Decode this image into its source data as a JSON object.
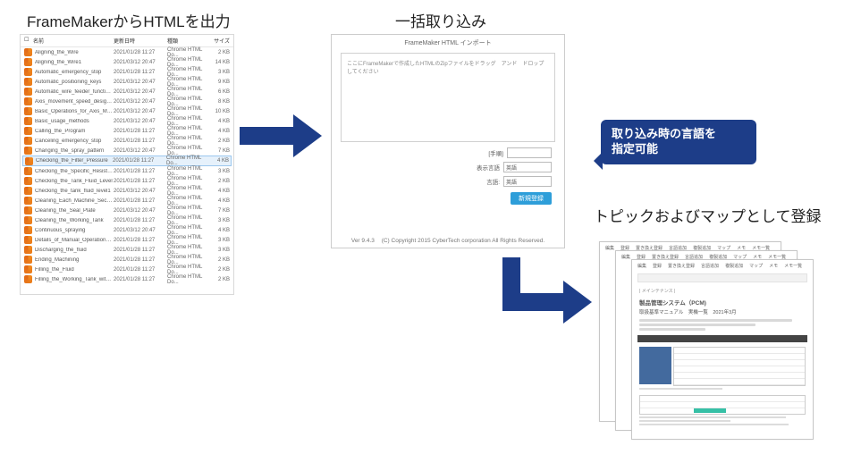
{
  "captions": {
    "export": "FrameMakerからHTMLを出力",
    "import": "一括取り込み",
    "register": "トピックおよびマップとして登録"
  },
  "callout": {
    "line1": "取り込み時の言語を",
    "line2": "指定可能"
  },
  "explorer": {
    "columns": {
      "name": "名前",
      "date": "更新日時",
      "type": "種類",
      "size": "サイズ"
    },
    "type_label": "Chrome HTML Do...",
    "selected_index": 11,
    "files": [
      {
        "name": "Aligning_the_Wire",
        "date": "2021/01/28 11:27",
        "size": "2 KB"
      },
      {
        "name": "Aligning_the_Wire1",
        "date": "2021/03/12 20:47",
        "size": "14 KB"
      },
      {
        "name": "Automatic_emergency_stop",
        "date": "2021/01/28 11:27",
        "size": "3 KB"
      },
      {
        "name": "Automatic_positioning_keys",
        "date": "2021/03/12 20:47",
        "size": "9 KB"
      },
      {
        "name": "Automatic_wire_feeder_function_keys",
        "date": "2021/03/12 20:47",
        "size": "6 KB"
      },
      {
        "name": "Axis_movement_speed_designation_k...",
        "date": "2021/03/12 20:47",
        "size": "8 KB"
      },
      {
        "name": "Basic_Operations_for_Axis_Movement",
        "date": "2021/03/12 20:47",
        "size": "10 KB"
      },
      {
        "name": "Basic_usage_methods",
        "date": "2021/03/12 20:47",
        "size": "4 KB"
      },
      {
        "name": "Calling_the_Program",
        "date": "2021/01/28 11:27",
        "size": "4 KB"
      },
      {
        "name": "Canceling_emergency_stop",
        "date": "2021/01/28 11:27",
        "size": "2 KB"
      },
      {
        "name": "Changing_the_spray_pattern",
        "date": "2021/03/12 20:47",
        "size": "7 KB"
      },
      {
        "name": "Checking_the_Filter_Pressure",
        "date": "2021/01/28 11:27",
        "size": "4 KB"
      },
      {
        "name": "Checking_the_Specific_Resistivity",
        "date": "2021/01/28 11:27",
        "size": "3 KB"
      },
      {
        "name": "Checking_the_Tank_Fluid_Level",
        "date": "2021/01/28 11:27",
        "size": "2 KB"
      },
      {
        "name": "Checking_the_tank_fluid_level1",
        "date": "2021/03/12 20:47",
        "size": "4 KB"
      },
      {
        "name": "Cleaning_Each_Machine_Section",
        "date": "2021/01/28 11:27",
        "size": "4 KB"
      },
      {
        "name": "Cleaning_the_Seal_Plate",
        "date": "2021/03/12 20:47",
        "size": "7 KB"
      },
      {
        "name": "Cleaning_the_Working_Tank",
        "date": "2021/01/28 11:27",
        "size": "3 KB"
      },
      {
        "name": "Continuous_spraying",
        "date": "2021/03/12 20:47",
        "size": "4 KB"
      },
      {
        "name": "Details_of_Manual_Operation_Box_fun...",
        "date": "2021/01/28 11:27",
        "size": "3 KB"
      },
      {
        "name": "Discharging_the_fluid",
        "date": "2021/01/28 11:27",
        "size": "3 KB"
      },
      {
        "name": "Ending_Machining",
        "date": "2021/01/28 11:27",
        "size": "2 KB"
      },
      {
        "name": "Filling_the_Fluid",
        "date": "2021/01/28 11:27",
        "size": "2 KB"
      },
      {
        "name": "Filling_the_Working_Tank_with_Dielect...",
        "date": "2021/01/28 11:27",
        "size": "2 KB"
      }
    ]
  },
  "importer": {
    "title": "FrameMaker HTML インポート",
    "drop_hint": "ここにFrameMakerで作成したHTMLのZipファイルをドラッグ　アンド　ドロップしてください",
    "fields": {
      "tezyun_label": "[手順]",
      "display_label": "表示言語",
      "display_value": "英語",
      "lang_label": "言語:",
      "lang_value": "英語"
    },
    "button": "新規登録",
    "version_label": "Ver 9.4.3",
    "copyright": "(C) Copyright 2015 CyberTech corporation All Rights Reserved."
  },
  "docpage": {
    "tabs": [
      "編集",
      "登録",
      "置き換え登録",
      "言語追加",
      "複製追加",
      "マップ",
      "メモ",
      "メモ一覧"
    ],
    "breadcrumb": "| メインテナンス |",
    "title": "製品管理システム（PCM)",
    "subtitle": "取扱基準マニュアル　実機一覧　2021年3月"
  }
}
